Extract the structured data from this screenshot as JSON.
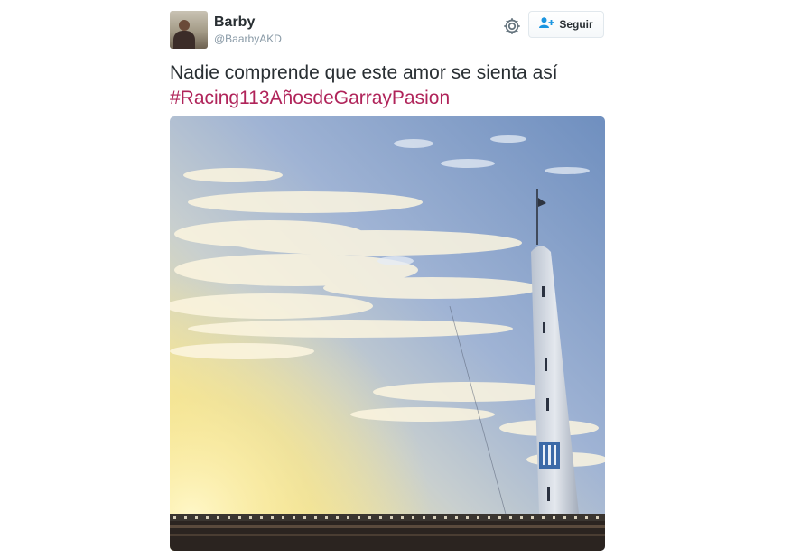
{
  "tweet": {
    "author": {
      "display_name": "Barby",
      "handle": "@BaarbyAKD"
    },
    "follow_label": "Seguir",
    "text": "Nadie comprende que este amor se sienta así",
    "hashtag": "#Racing113AñosdeGarrayPasion"
  },
  "icons": {
    "settings": "gear-icon",
    "follow": "add-person-icon"
  },
  "colors": {
    "hashtag": "#b0245a",
    "text": "#292f33",
    "handle": "#8899a6",
    "follow_icon": "#1b95e0"
  }
}
